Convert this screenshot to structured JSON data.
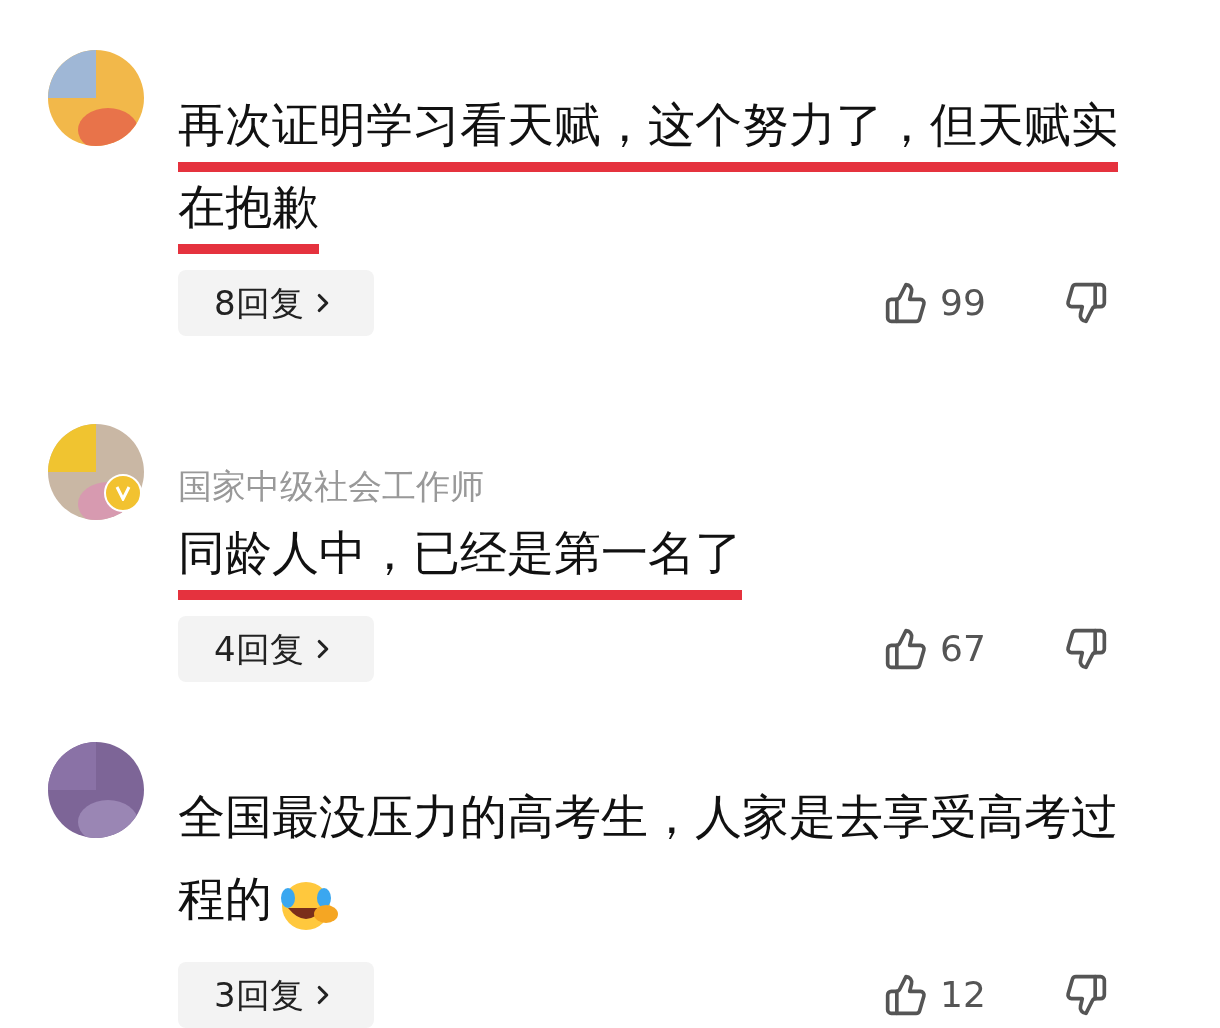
{
  "comments": [
    {
      "badge": false,
      "lines": [
        "再次证明学习看天赋，这个努力了，但天赋实",
        "在抱歉"
      ],
      "emoji": false,
      "underlined": true,
      "replies": "8回复",
      "likes": "99"
    },
    {
      "badge": true,
      "subtitle": "国家中级社会工作师",
      "lines": [
        "同龄人中，已经是第一名了"
      ],
      "emoji": false,
      "underlined": true,
      "replies": "4回复",
      "likes": "67"
    },
    {
      "badge": false,
      "lines": [
        "全国最没压力的高考生，人家是去享受高考过",
        "程的"
      ],
      "emoji": true,
      "underlined": false,
      "replies": "3回复",
      "likes": "12"
    }
  ]
}
